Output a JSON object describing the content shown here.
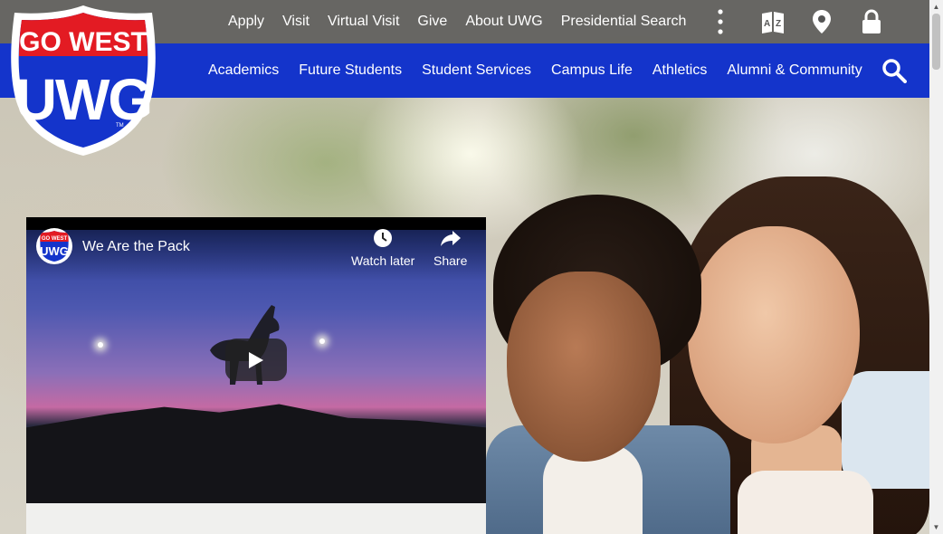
{
  "logo": {
    "line1": "GO WEST",
    "line2": "UWG",
    "tm": "TM"
  },
  "utility_nav": {
    "links": [
      "Apply",
      "Visit",
      "Virtual Visit",
      "Give",
      "About UWG",
      "Presidential Search"
    ],
    "icons": [
      "more-vertical-icon",
      "a-z-index-icon",
      "map-marker-icon",
      "lock-icon"
    ]
  },
  "main_nav": {
    "links": [
      "Academics",
      "Future Students",
      "Student Services",
      "Campus Life",
      "Athletics",
      "Alumni & Community"
    ],
    "search_icon": "search-icon"
  },
  "video": {
    "title": "We Are the Pack",
    "channel_logo_line1": "GO WEST",
    "channel_logo_line2": "UWG",
    "watch_later": "Watch later",
    "share": "Share",
    "play_icon": "play-icon"
  },
  "colors": {
    "brand_blue": "#1434cb",
    "brand_red": "#e31b23"
  }
}
